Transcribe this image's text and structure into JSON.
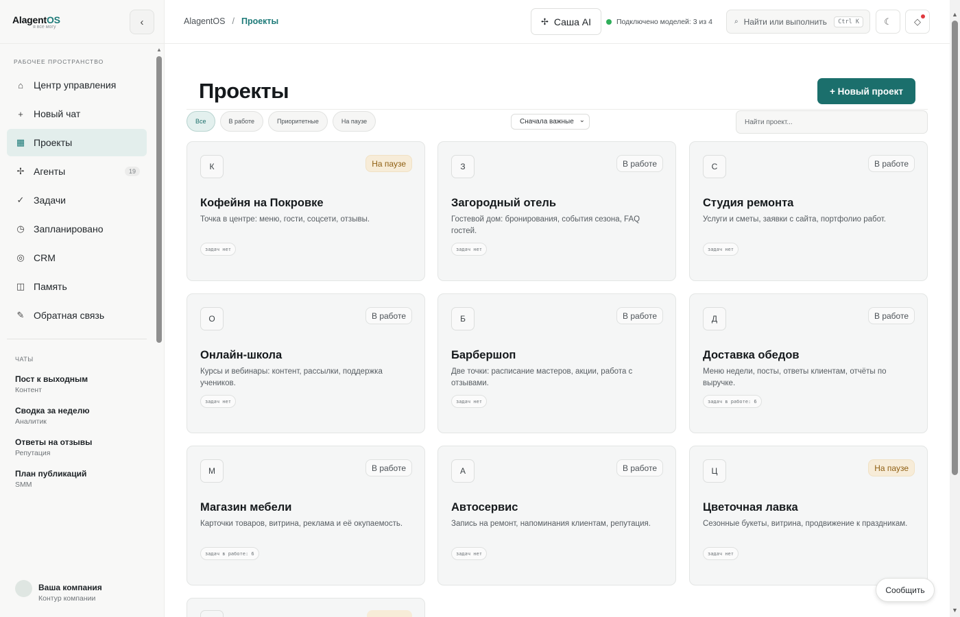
{
  "brand": {
    "name_main": "Alagent",
    "name_accent": "OS",
    "tagline": "я все могу"
  },
  "sidebar": {
    "workspace_label": "Рабочее пространство",
    "items": [
      {
        "icon": "home-icon",
        "glyph": "⌂",
        "label": "Центр управления",
        "active": false
      },
      {
        "icon": "plus-icon",
        "glyph": "+",
        "label": "Новый чат",
        "active": false
      },
      {
        "icon": "grid-icon",
        "glyph": "▦",
        "label": "Проекты",
        "active": true
      },
      {
        "icon": "agents-icon",
        "glyph": "✢",
        "label": "Агенты",
        "count": "19",
        "active": false
      },
      {
        "icon": "check-icon",
        "glyph": "✓",
        "label": "Задачи",
        "active": false
      },
      {
        "icon": "clock-icon",
        "glyph": "◷",
        "label": "Запланировано",
        "active": false
      },
      {
        "icon": "crm-icon",
        "glyph": "◎",
        "label": "CRM",
        "active": false
      },
      {
        "icon": "book-icon",
        "glyph": "◫",
        "label": "Память",
        "active": false
      },
      {
        "icon": "pencil-icon",
        "glyph": "✎",
        "label": "Обратная связь",
        "active": false
      }
    ],
    "chats_label": "ЧАТЫ",
    "chats": [
      {
        "title": "Пост к выходным",
        "sub": "Контент"
      },
      {
        "title": "Сводка за неделю",
        "sub": "Аналитик"
      },
      {
        "title": "Ответы на отзывы",
        "sub": "Репутация"
      },
      {
        "title": "План публикаций",
        "sub": "SMM"
      }
    ],
    "company": {
      "name": "Ваша компания",
      "sub": "Контур компании"
    }
  },
  "topbar": {
    "breadcrumb_root": "AlagentOS",
    "breadcrumb_sep": "/",
    "breadcrumb_current": "Проекты",
    "assistant_label": "Саша AI",
    "status_text": "Подключено моделей: 3 из 4",
    "status_color": "#2fae5a",
    "search_label": "Найти или выполнить",
    "search_shortcut": "Ctrl K"
  },
  "main": {
    "title": "Проекты",
    "new_project_label": "+  Новый проект",
    "filters": [
      {
        "label": "Все",
        "active": true
      },
      {
        "label": "В работе",
        "active": false
      },
      {
        "label": "Приоритетные",
        "active": false
      },
      {
        "label": "На паузе",
        "active": false
      }
    ],
    "sort_value": "Сначала важные",
    "search_placeholder": "Найти проект..."
  },
  "projects": [
    {
      "letter": "К",
      "status": "На паузе",
      "paused": true,
      "title": "Кофейня на Покровке",
      "desc": "Точка в центре: меню, гости, соцсети, отзывы.",
      "tasks": "задач нет"
    },
    {
      "letter": "З",
      "status": "В работе",
      "paused": false,
      "title": "Загородный отель",
      "desc": "Гостевой дом: бронирования, события сезона, FAQ гостей.",
      "tasks": "задач нет"
    },
    {
      "letter": "С",
      "status": "В работе",
      "paused": false,
      "title": "Студия ремонта",
      "desc": "Услуги и сметы, заявки с сайта, портфолио работ.",
      "tasks": "задач нет"
    },
    {
      "letter": "О",
      "status": "В работе",
      "paused": false,
      "title": "Онлайн-школа",
      "desc": "Курсы и вебинары: контент, рассылки, поддержка учеников.",
      "tasks": "задач нет"
    },
    {
      "letter": "Б",
      "status": "В работе",
      "paused": false,
      "title": "Барбершоп",
      "desc": "Две точки: расписание мастеров, акции, работа с отзывами.",
      "tasks": "задач нет"
    },
    {
      "letter": "Д",
      "status": "В работе",
      "paused": false,
      "title": "Доставка обедов",
      "desc": "Меню недели, посты, ответы клиентам, отчёты по выручке.",
      "tasks": "задач в работе: 6"
    },
    {
      "letter": "М",
      "status": "В работе",
      "paused": false,
      "title": "Магазин мебели",
      "desc": "Карточки товаров, витрина, реклама и её окупаемость.",
      "tasks": "задач в работе: 6"
    },
    {
      "letter": "А",
      "status": "В работе",
      "paused": false,
      "title": "Автосервис",
      "desc": "Запись на ремонт, напоминания клиентам, репутация.",
      "tasks": "задач нет"
    },
    {
      "letter": "Ц",
      "status": "На паузе",
      "paused": true,
      "title": "Цветочная лавка",
      "desc": "Сезонные букеты, витрина, продвижение к праздникам.",
      "tasks": "задач нет"
    }
  ],
  "report_label": "Сообщить"
}
